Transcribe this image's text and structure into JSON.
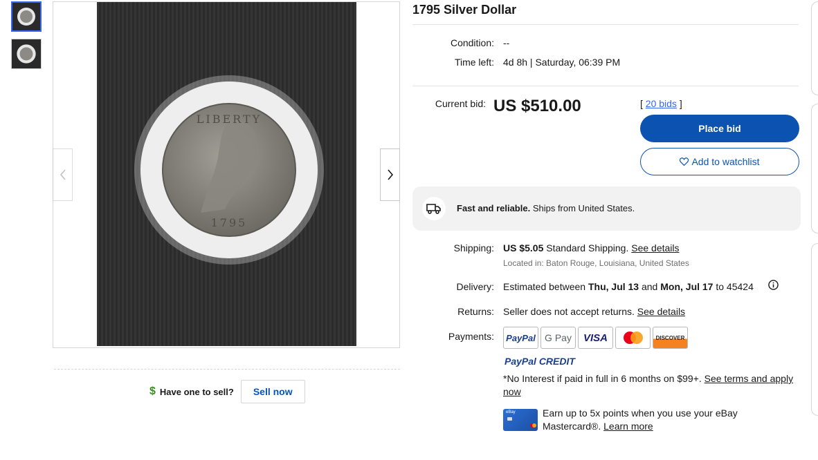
{
  "listing": {
    "title": "1795 Silver Dollar"
  },
  "details": {
    "condition_label": "Condition:",
    "condition_value": "--",
    "time_left_label": "Time left:",
    "time_left_value": "4d 8h | Saturday, 06:39 PM"
  },
  "bidding": {
    "current_bid_label": "Current bid:",
    "current_bid_value": "US $510.00",
    "bids_open": "[",
    "bids_link": "20 bids",
    "bids_close": "]",
    "place_bid_label": "Place bid",
    "watchlist_label": "Add to watchlist"
  },
  "fast_reliable": {
    "bold": "Fast and reliable.",
    "text": " Ships from United States."
  },
  "shipping": {
    "label": "Shipping:",
    "price": "US $5.05",
    "method": " Standard Shipping. ",
    "details_link": "See details",
    "located": "Located in: Baton Rouge, Louisiana, United States"
  },
  "delivery": {
    "label": "Delivery:",
    "prefix": "Estimated between ",
    "date1": "Thu, Jul 13",
    "mid": " and ",
    "date2": "Mon, Jul 17",
    "suffix": " to 45424"
  },
  "returns": {
    "label": "Returns:",
    "text": "Seller does not accept returns. ",
    "details_link": "See details"
  },
  "payments": {
    "label": "Payments:",
    "methods": [
      "PayPal",
      "G Pay",
      "VISA",
      "Mastercard",
      "DISCOVER"
    ],
    "paypal_credit": "PayPal CREDIT",
    "no_interest": "*No Interest if paid in full in 6 months on $99+. ",
    "terms_link": "See terms and apply now"
  },
  "promo": {
    "card_label": "eBay",
    "text": "Earn up to 5x points when you use your eBay Mastercard®. ",
    "learn_more": "Learn more"
  },
  "sell": {
    "question": "Have one to sell?",
    "button": "Sell now"
  },
  "colors": {
    "primary_blue": "#0b52b1",
    "link_blue": "#3665f3",
    "dollar_green": "#3a8e26"
  }
}
